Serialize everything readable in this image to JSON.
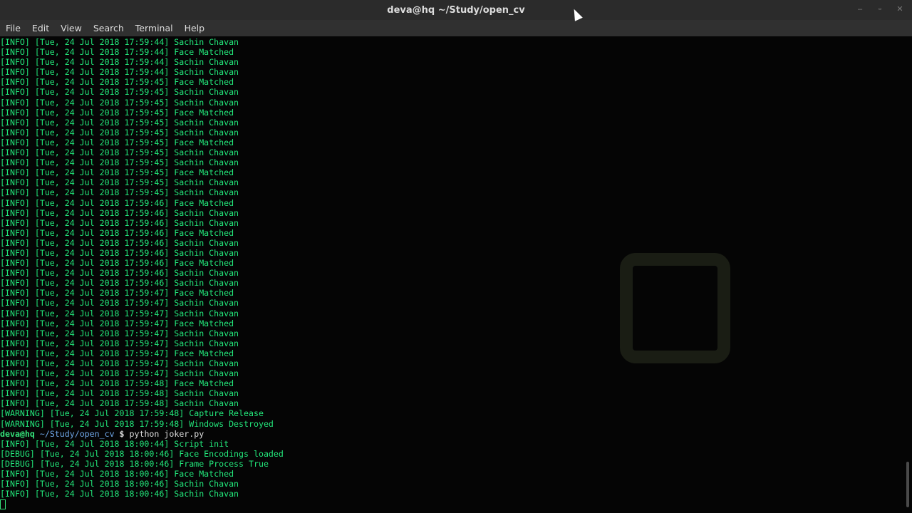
{
  "window": {
    "title": "deva@hq ~/Study/open_cv"
  },
  "menu": [
    "File",
    "Edit",
    "View",
    "Search",
    "Terminal",
    "Help"
  ],
  "terminal": {
    "lines": [
      "[INFO] [Tue, 24 Jul 2018 17:59:44] Sachin Chavan",
      "[INFO] [Tue, 24 Jul 2018 17:59:44] Face Matched",
      "[INFO] [Tue, 24 Jul 2018 17:59:44] Sachin Chavan",
      "[INFO] [Tue, 24 Jul 2018 17:59:44] Sachin Chavan",
      "[INFO] [Tue, 24 Jul 2018 17:59:45] Face Matched",
      "[INFO] [Tue, 24 Jul 2018 17:59:45] Sachin Chavan",
      "[INFO] [Tue, 24 Jul 2018 17:59:45] Sachin Chavan",
      "[INFO] [Tue, 24 Jul 2018 17:59:45] Face Matched",
      "[INFO] [Tue, 24 Jul 2018 17:59:45] Sachin Chavan",
      "[INFO] [Tue, 24 Jul 2018 17:59:45] Sachin Chavan",
      "[INFO] [Tue, 24 Jul 2018 17:59:45] Face Matched",
      "[INFO] [Tue, 24 Jul 2018 17:59:45] Sachin Chavan",
      "[INFO] [Tue, 24 Jul 2018 17:59:45] Sachin Chavan",
      "[INFO] [Tue, 24 Jul 2018 17:59:45] Face Matched",
      "[INFO] [Tue, 24 Jul 2018 17:59:45] Sachin Chavan",
      "[INFO] [Tue, 24 Jul 2018 17:59:45] Sachin Chavan",
      "[INFO] [Tue, 24 Jul 2018 17:59:46] Face Matched",
      "[INFO] [Tue, 24 Jul 2018 17:59:46] Sachin Chavan",
      "[INFO] [Tue, 24 Jul 2018 17:59:46] Sachin Chavan",
      "[INFO] [Tue, 24 Jul 2018 17:59:46] Face Matched",
      "[INFO] [Tue, 24 Jul 2018 17:59:46] Sachin Chavan",
      "[INFO] [Tue, 24 Jul 2018 17:59:46] Sachin Chavan",
      "[INFO] [Tue, 24 Jul 2018 17:59:46] Face Matched",
      "[INFO] [Tue, 24 Jul 2018 17:59:46] Sachin Chavan",
      "[INFO] [Tue, 24 Jul 2018 17:59:46] Sachin Chavan",
      "[INFO] [Tue, 24 Jul 2018 17:59:47] Face Matched",
      "[INFO] [Tue, 24 Jul 2018 17:59:47] Sachin Chavan",
      "[INFO] [Tue, 24 Jul 2018 17:59:47] Sachin Chavan",
      "[INFO] [Tue, 24 Jul 2018 17:59:47] Face Matched",
      "[INFO] [Tue, 24 Jul 2018 17:59:47] Sachin Chavan",
      "[INFO] [Tue, 24 Jul 2018 17:59:47] Sachin Chavan",
      "[INFO] [Tue, 24 Jul 2018 17:59:47] Face Matched",
      "[INFO] [Tue, 24 Jul 2018 17:59:47] Sachin Chavan",
      "[INFO] [Tue, 24 Jul 2018 17:59:47] Sachin Chavan",
      "[INFO] [Tue, 24 Jul 2018 17:59:48] Face Matched",
      "[INFO] [Tue, 24 Jul 2018 17:59:48] Sachin Chavan",
      "[INFO] [Tue, 24 Jul 2018 17:59:48] Sachin Chavan",
      "[WARNING] [Tue, 24 Jul 2018 17:59:48] Capture Release",
      "[WARNING] [Tue, 24 Jul 2018 17:59:48] Windows Destroyed"
    ],
    "prompt": {
      "user": "deva@hq",
      "path": "~/Study/open_cv",
      "symbol": "$",
      "command": "python joker.py"
    },
    "after_lines": [
      "[INFO] [Tue, 24 Jul 2018 18:00:44] Script init",
      "[DEBUG] [Tue, 24 Jul 2018 18:00:46] Face Encodings loaded",
      "[DEBUG] [Tue, 24 Jul 2018 18:00:46] Frame Process True",
      "[INFO] [Tue, 24 Jul 2018 18:00:46] Face Matched",
      "[INFO] [Tue, 24 Jul 2018 18:00:46] Sachin Chavan",
      "[INFO] [Tue, 24 Jul 2018 18:00:46] Sachin Chavan"
    ]
  },
  "colors": {
    "output": "#22e67a",
    "prompt_user": "#34e27a",
    "prompt_path": "#6fa7e8",
    "background": "#050505"
  }
}
